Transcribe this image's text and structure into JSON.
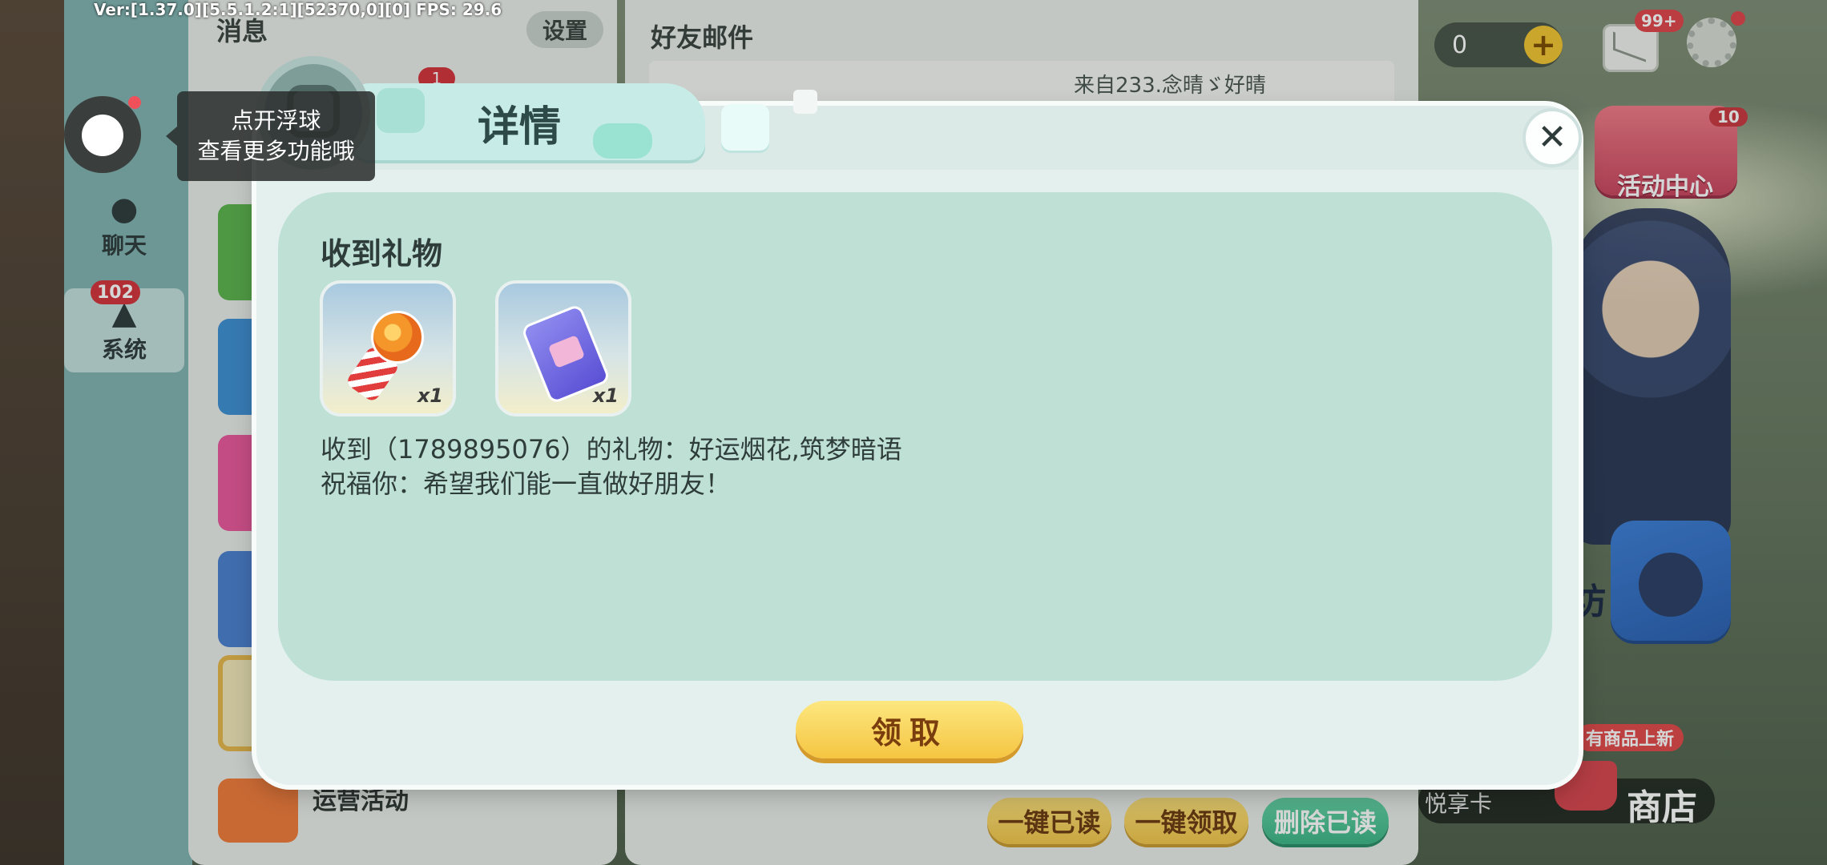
{
  "debug": {
    "version": "Ver:[1.37.0][5.5.1.2:1][52370,0][0] FPS: 29.6"
  },
  "hud": {
    "coin_value": "0",
    "plus_label": "+",
    "mail_badge": "99+",
    "activity_center": {
      "label": "活动中心",
      "badge": "10"
    },
    "shop": {
      "new_goods_label": "有商品上新",
      "yuexiang_label": "悦享卡",
      "shop_label": "商店"
    },
    "hammer_text": "坊"
  },
  "left_nav": {
    "items": [
      {
        "label": "聊天",
        "icon": "chat-bubble-icon"
      },
      {
        "label": "系统",
        "icon": "bell-icon",
        "badge": "102"
      }
    ]
  },
  "message_panel": {
    "title": "消息",
    "settings_label": "设置",
    "badge": "1",
    "ops_label": "运营活动"
  },
  "mail_panel": {
    "title": "好友邮件",
    "row_from": "来自233.念晴ゞ好晴",
    "buttons": {
      "mark_all_read": "一键已读",
      "collect_all": "一键领取",
      "delete_read": "删除已读"
    }
  },
  "floating_ball": {
    "tooltip_line1": "点开浮球",
    "tooltip_line2": "查看更多功能哦"
  },
  "modal": {
    "title": "详情",
    "close_label": "✕",
    "section_title": "收到礼物",
    "gifts": [
      {
        "name": "好运烟花",
        "icon": "firework-icon",
        "qty": "x1"
      },
      {
        "name": "筑梦暗语",
        "icon": "card-pack-icon",
        "qty": "x1"
      }
    ],
    "desc_line1": "收到（1789895076）的礼物：好运烟花,筑梦暗语",
    "desc_line2": "祝福你：希望我们能一直做好朋友！",
    "claim_label": "领取"
  },
  "colors": {
    "modal_bg": "#e4f0ee",
    "inner_bg": "#bfe0d5",
    "claim_button": "#f5c541",
    "delete_button": "#3bb585",
    "badge_red": "#d3333b"
  }
}
